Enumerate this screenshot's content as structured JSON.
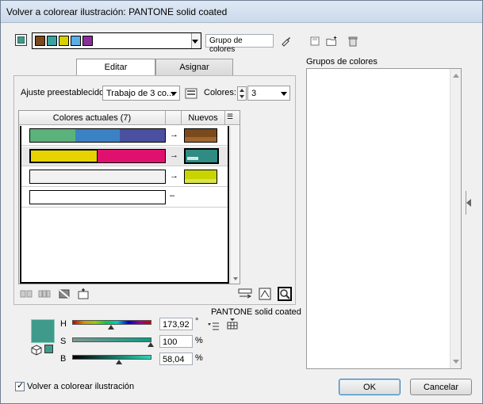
{
  "window": {
    "title": "Volver a colorear ilustración: PANTONE solid coated"
  },
  "top": {
    "group_name_field": "Grupo de colores",
    "preview_swatches": [
      "#3f9a8a"
    ],
    "strip_colors": [
      "#7a4a1c",
      "#3aa3a0",
      "#d6d000",
      "#5aaee3",
      "#8a2d9a"
    ]
  },
  "tabs": {
    "edit": "Editar",
    "assign": "Asignar"
  },
  "preset": {
    "label": "Ajuste preestablecido:",
    "value": "Trabajo de 3 co...",
    "colors_label": "Colores:",
    "colors_value": "3"
  },
  "table": {
    "header_current": "Colores actuales (7)",
    "header_new": "Nuevos",
    "rows": [
      {
        "current": [
          "#5bb27a",
          "#3b82c4",
          "#4a4fa0"
        ],
        "new": [
          "#7a4a1c",
          "#7a4a1c"
        ],
        "arrow": "→"
      },
      {
        "current": [
          "#e6d300",
          "#e0106f"
        ],
        "new": [
          "#2e8c83",
          "#2e8c83"
        ],
        "arrow": "→"
      },
      {
        "current": [
          "#f2f2f2"
        ],
        "new": [
          "#c8d400",
          "#c8d400"
        ],
        "arrow": "→"
      },
      {
        "current": [
          "#ffffff"
        ],
        "new": [],
        "arrow": "–"
      }
    ]
  },
  "color_library": "PANTONE solid coated",
  "hsb": {
    "h_label": "H",
    "h_value": "173,92",
    "h_unit": "°",
    "s_label": "S",
    "s_value": "100",
    "s_unit": "%",
    "b_label": "B",
    "b_value": "58,04",
    "b_unit": "%",
    "swatch": "#3f9a8a"
  },
  "groups": {
    "title": "Grupos de colores"
  },
  "footer": {
    "recolor_checkbox": "Volver a colorear ilustración",
    "ok": "OK",
    "cancel": "Cancelar"
  }
}
